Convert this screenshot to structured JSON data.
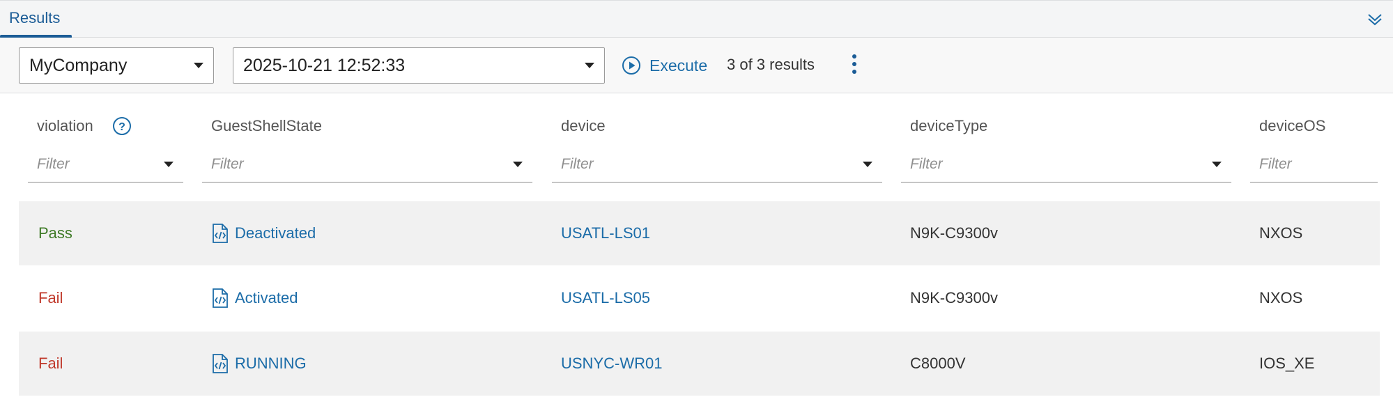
{
  "tabs": [
    {
      "label": "Results",
      "active": true
    }
  ],
  "toolbar": {
    "company": "MyCompany",
    "datetime": "2025-10-21 12:52:33",
    "execute_label": "Execute",
    "result_count": "3 of 3 results"
  },
  "columns": [
    {
      "label": "violation",
      "filter_placeholder": "Filter"
    },
    {
      "label": "GuestShellState",
      "filter_placeholder": "Filter"
    },
    {
      "label": "device",
      "filter_placeholder": "Filter"
    },
    {
      "label": "deviceType",
      "filter_placeholder": "Filter"
    },
    {
      "label": "deviceOS",
      "filter_placeholder": "Filter"
    }
  ],
  "rows": [
    {
      "violation": "Pass",
      "state": "Deactivated",
      "device": "USATL-LS01",
      "deviceType": "N9K-C9300v",
      "deviceOS": "NXOS"
    },
    {
      "violation": "Fail",
      "state": "Activated",
      "device": "USATL-LS05",
      "deviceType": "N9K-C9300v",
      "deviceOS": "NXOS"
    },
    {
      "violation": "Fail",
      "state": "RUNNING",
      "device": "USNYC-WR01",
      "deviceType": "C8000V",
      "deviceOS": "IOS_XE"
    }
  ],
  "icons": {
    "collapse": "double-chevron-down-icon",
    "execute": "play-circle-icon",
    "more": "kebab-menu-icon",
    "help": "question-circle-icon",
    "state": "code-file-icon"
  },
  "colors": {
    "accent": "#1b5c96",
    "link": "#1b6ca8",
    "pass": "#3e7a26",
    "fail": "#c0392b"
  }
}
